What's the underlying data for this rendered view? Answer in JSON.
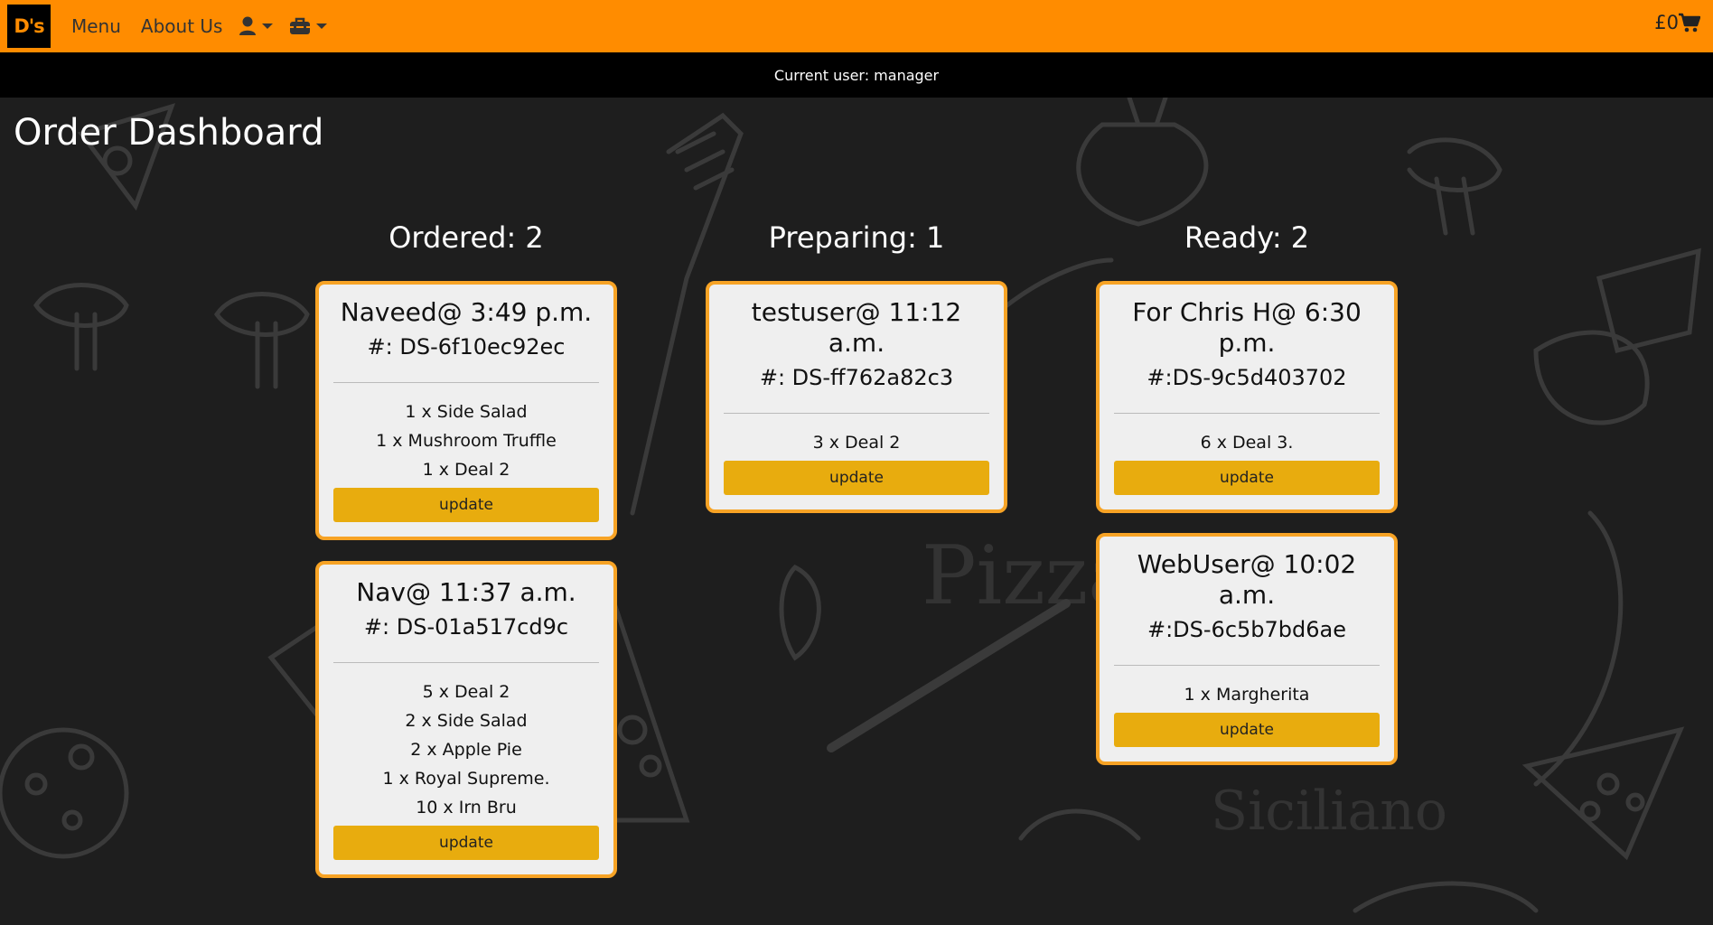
{
  "navbar": {
    "logo": "D's",
    "menu_label": "Menu",
    "about_label": "About Us",
    "cart_total": "£0"
  },
  "userbar": {
    "text": "Current user: manager"
  },
  "page": {
    "title": "Order Dashboard"
  },
  "columns": [
    {
      "heading": "Ordered: 2",
      "cards": [
        {
          "title": "Naveed@ 3:49 p.m.",
          "order_id": "#: DS-6f10ec92ec",
          "items": [
            "1 x Side Salad",
            "1 x Mushroom Truffle",
            "1 x Deal 2"
          ],
          "button": "update"
        },
        {
          "title": "Nav@ 11:37 a.m.",
          "order_id": "#: DS-01a517cd9c",
          "items": [
            "5 x Deal 2",
            "2 x Side Salad",
            "2 x Apple Pie",
            "1 x Royal Supreme.",
            "10 x Irn Bru"
          ],
          "button": "update"
        }
      ]
    },
    {
      "heading": "Preparing: 1",
      "cards": [
        {
          "title": "testuser@ 11:12 a.m.",
          "order_id": "#: DS-ff762a82c3",
          "items": [
            "3 x Deal 2"
          ],
          "button": "update"
        }
      ]
    },
    {
      "heading": "Ready: 2",
      "cards": [
        {
          "title": "For Chris H@ 6:30 p.m.",
          "order_id": "#:DS-9c5d403702",
          "items": [
            "6 x Deal 3."
          ],
          "button": "update"
        },
        {
          "title": "WebUser@ 10:02 a.m.",
          "order_id": "#:DS-6c5b7bd6ae",
          "items": [
            "1 x Margherita"
          ],
          "button": "update"
        }
      ]
    }
  ],
  "icons": {
    "user": "user-icon",
    "toolbox": "toolbox-icon",
    "cart": "cart-icon"
  },
  "colors": {
    "nav_bg": "#ff8c00",
    "card_border": "#f7a325",
    "button_bg": "#e8ac0e",
    "page_bg": "#1e1e1e"
  }
}
